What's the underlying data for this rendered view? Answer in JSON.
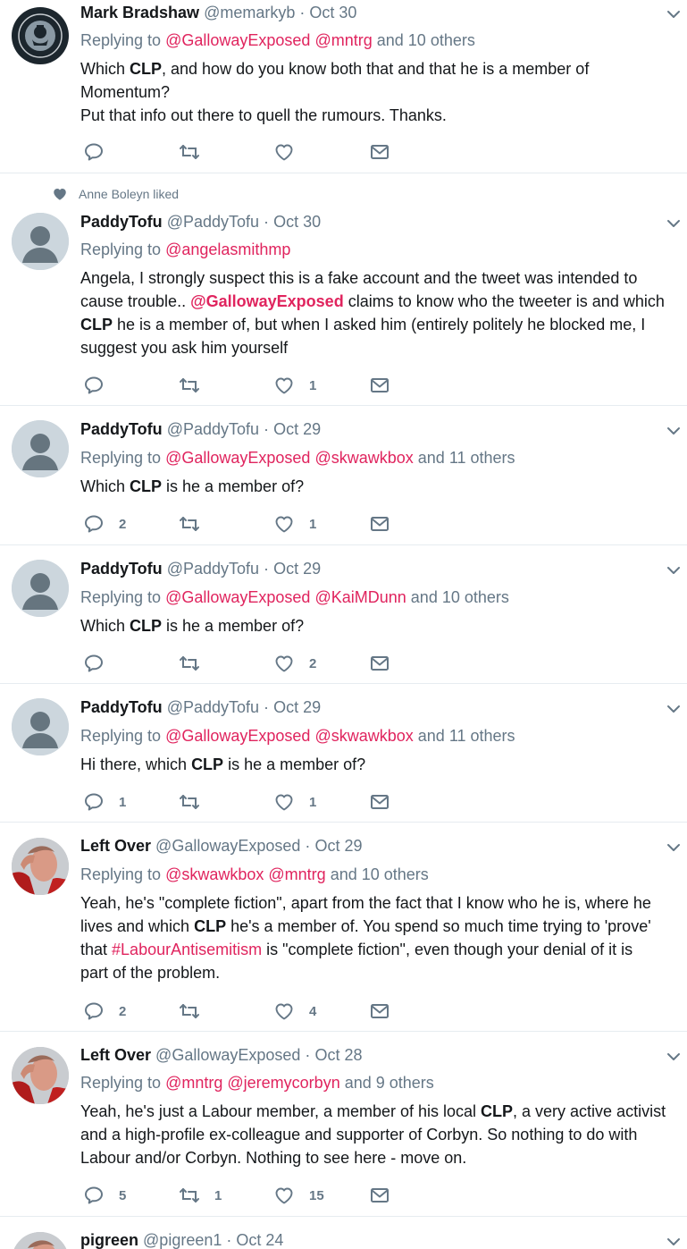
{
  "colors": {
    "accent": "#e0245e",
    "muted": "#657786",
    "text": "#14171a",
    "border": "#e6ecf0"
  },
  "tweets": [
    {
      "name": "Mark Bradshaw",
      "handle": "@memarkyb",
      "date": "Oct 30",
      "reply_prefix": "Replying to",
      "reply_mentions": [
        "@GallowayExposed",
        "@mntrg"
      ],
      "reply_suffix": "and 10 others",
      "text_lines": [
        "Which ",
        "CLP",
        ", and how do you know both that and that he is a member of",
        "Momentum?",
        "Put that info out there to quell the rumours. Thanks."
      ],
      "counts": {
        "replies": "",
        "retweets": "",
        "likes": ""
      },
      "avatar": "team-kubicon-badge"
    },
    {
      "social_context": "Anne Boleyn liked",
      "name": "PaddyTofu",
      "handle": "@PaddyTofu",
      "date": "Oct 30",
      "reply_prefix": "Replying to",
      "reply_mentions": [
        "@angelasmithmp"
      ],
      "reply_suffix": "",
      "text_parts": {
        "p1": "Angela, I strongly suspect this is a fake account and the tweet was intended to",
        "p2": "cause trouble.. ",
        "mention": "@GallowayExposed",
        "p3": " claims to know who the tweeter is and which",
        "clp": "CLP",
        "p4": " he is a member of, but when I asked him (entirely politely he blocked me, I",
        "p5": "suggest you ask him yourself"
      },
      "counts": {
        "replies": "",
        "retweets": "",
        "likes": "1"
      },
      "avatar": "default-avatar"
    },
    {
      "name": "PaddyTofu",
      "handle": "@PaddyTofu",
      "date": "Oct 29",
      "reply_prefix": "Replying to",
      "reply_mentions": [
        "@GallowayExposed",
        "@skwawkbox"
      ],
      "reply_suffix": "and 11 others",
      "text_parts": {
        "pre": "Which ",
        "clp": "CLP",
        "post": " is he a member of?"
      },
      "counts": {
        "replies": "2",
        "retweets": "",
        "likes": "1"
      },
      "avatar": "default-avatar"
    },
    {
      "name": "PaddyTofu",
      "handle": "@PaddyTofu",
      "date": "Oct 29",
      "reply_prefix": "Replying to",
      "reply_mentions": [
        "@GallowayExposed",
        "@KaiMDunn"
      ],
      "reply_suffix": "and 10 others",
      "text_parts": {
        "pre": "Which ",
        "clp": "CLP",
        "post": " is he a member of?"
      },
      "counts": {
        "replies": "",
        "retweets": "",
        "likes": "2"
      },
      "avatar": "default-avatar"
    },
    {
      "name": "PaddyTofu",
      "handle": "@PaddyTofu",
      "date": "Oct 29",
      "reply_prefix": "Replying to",
      "reply_mentions": [
        "@GallowayExposed",
        "@skwawkbox"
      ],
      "reply_suffix": "and 11 others",
      "text_parts": {
        "pre": "Hi there, which ",
        "clp": "CLP",
        "post": " is he a member of?"
      },
      "counts": {
        "replies": "1",
        "retweets": "",
        "likes": "1"
      },
      "avatar": "default-avatar"
    },
    {
      "name": "Left Over",
      "handle": "@GallowayExposed",
      "date": "Oct 29",
      "reply_prefix": "Replying to",
      "reply_mentions": [
        "@skwawkbox",
        "@mntrg"
      ],
      "reply_suffix": "and 10 others",
      "text_parts": {
        "l1": "Yeah, he's \"complete fiction\", apart from the fact that I know who he is, where he",
        "l2a": "lives and which ",
        "clp": "CLP",
        "l2b": " he's a member of. You spend so much time trying to 'prove'",
        "l3a": "that ",
        "hashtag": "#LabourAntisemitism",
        "l3b": " is \"complete fiction\", even though your denial of it is",
        "l4": "part of the problem."
      },
      "counts": {
        "replies": "2",
        "retweets": "",
        "likes": "4"
      },
      "avatar": "photo-man"
    },
    {
      "name": "Left Over",
      "handle": "@GallowayExposed",
      "date": "Oct 28",
      "reply_prefix": "Replying to",
      "reply_mentions": [
        "@mntrg",
        "@jeremycorbyn"
      ],
      "reply_suffix": "and 9 others",
      "text_parts": {
        "l1a": "Yeah, he's just a Labour member, a member of his local ",
        "clp": "CLP",
        "l1b": ", a very active activist",
        "l2": "and a high-profile ex-colleague and supporter of Corbyn. So nothing to do with",
        "l3": "Labour and/or Corbyn. Nothing to see here - move on."
      },
      "counts": {
        "replies": "5",
        "retweets": "1",
        "likes": "15"
      },
      "avatar": "photo-man"
    },
    {
      "name": "pigreen",
      "handle": "@pigreen1",
      "date": "Oct 24",
      "avatar": "photo-partial"
    }
  ]
}
